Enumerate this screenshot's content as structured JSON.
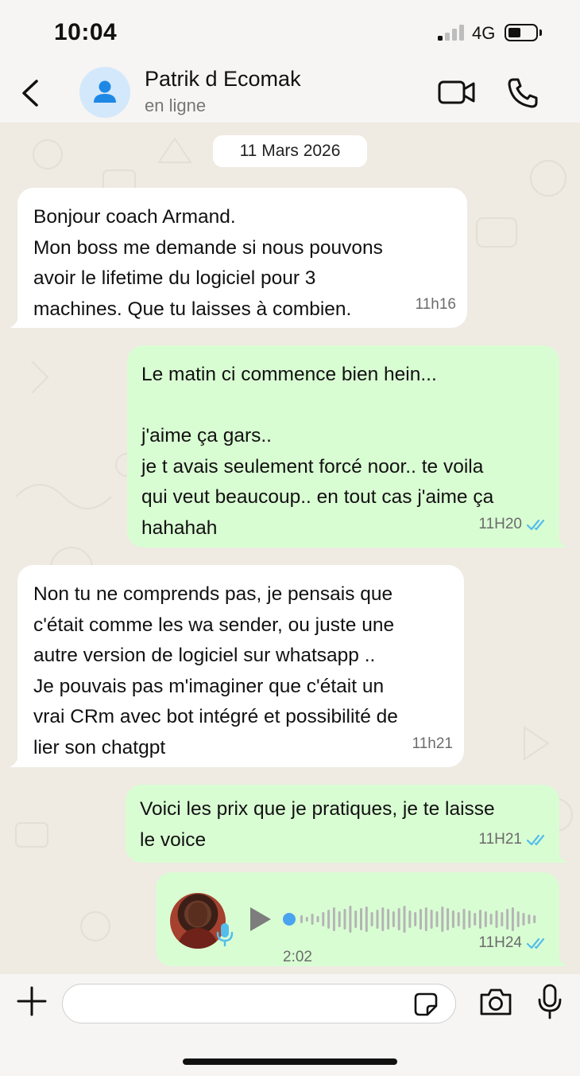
{
  "status_bar": {
    "time": "10:04",
    "network": "4G"
  },
  "header": {
    "contact_name": "Patrik d Ecomak",
    "contact_status": "en ligne"
  },
  "chat": {
    "date": "11 Mars 2026",
    "messages": [
      {
        "direction": "in",
        "text": "Bonjour coach Armand.\nMon boss me demande si nous pouvons\navoir le lifetime du logiciel pour 3\nmachines. Que tu laisses à combien.",
        "time": "11h16"
      },
      {
        "direction": "out",
        "text": "Le matin ci commence bien hein...\n\nj'aime ça gars..\nje t avais seulement forcé noor.. te voila\nqui veut beaucoup.. en tout cas j'aime ça\nhahahah",
        "time": "11H20",
        "read": true
      },
      {
        "direction": "in",
        "text": "Non tu ne comprends pas, je pensais que\nc'était comme les wa sender, ou juste une\nautre version de logiciel sur whatsapp ..\nJe pouvais pas m'imaginer que c'était un\nvrai CRm avec bot intégré et possibilité de\nlier son chatgpt",
        "time": "11h21"
      },
      {
        "direction": "out",
        "text": "Voici les prix que je pratiques, je te laisse\nle voice",
        "time": "11H21",
        "read": true
      }
    ],
    "voice_message": {
      "direction": "out",
      "duration": "2:02",
      "time": "11H24",
      "read": true,
      "progress": 0
    }
  },
  "input_bar": {
    "placeholder": ""
  },
  "colors": {
    "outgoing_bubble": "#d9fdd3",
    "incoming_bubble": "#ffffff",
    "chat_background": "#efeae2",
    "read_ticks": "#53bdeb",
    "avatar_bg": "#d3e8fb",
    "avatar_icon": "#1e88e5"
  },
  "icons": [
    "back-icon",
    "contact-avatar-icon",
    "video-call-icon",
    "phone-icon",
    "double-check-icon",
    "play-icon",
    "microphone-icon",
    "plus-icon",
    "sticker-icon",
    "camera-icon"
  ]
}
